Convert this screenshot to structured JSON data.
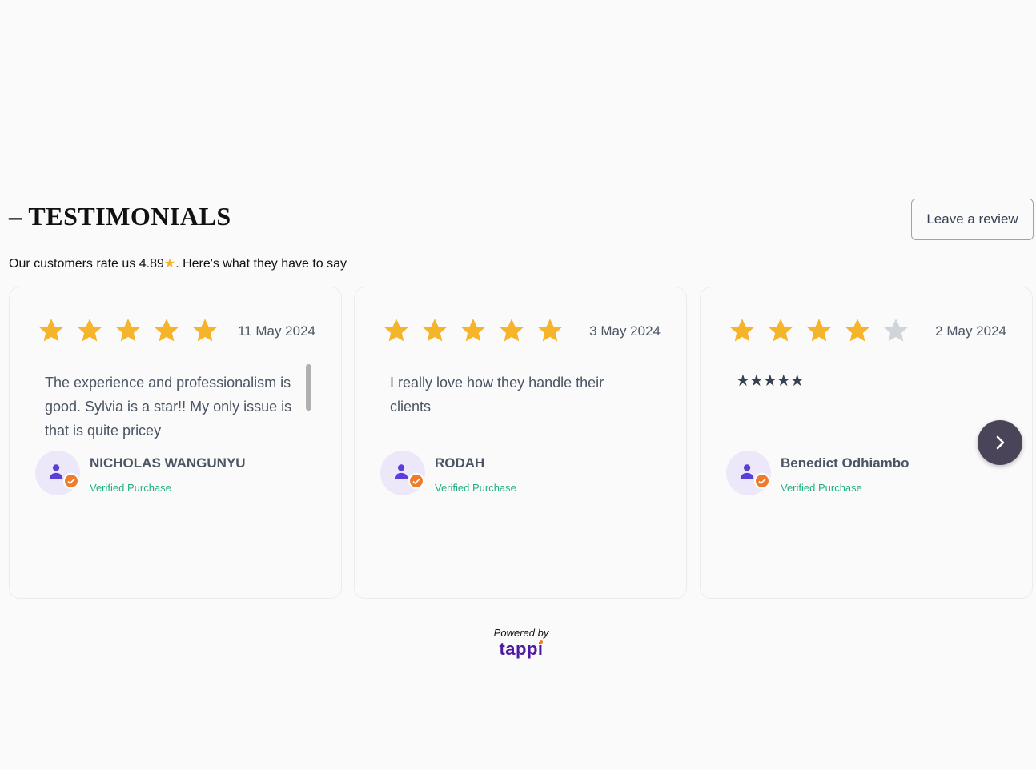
{
  "section": {
    "title": "– TESTIMONIALS",
    "leave_review_label": "Leave a review",
    "subtitle_before": "Our customers rate us 4.89",
    "subtitle_star": "★",
    "subtitle_after": ". Here's what they have to say"
  },
  "reviews": [
    {
      "rating": 5,
      "date": "11 May 2024",
      "text": "The experience and professionalism is good. Sylvia is a star!! My only issue is that is quite pricey",
      "name": "NICHOLAS WANGUNYU",
      "verified": "Verified Purchase"
    },
    {
      "rating": 5,
      "date": "3 May 2024",
      "text": "I really love how they handle their clients",
      "name": "RODAH",
      "verified": "Verified Purchase"
    },
    {
      "rating": 4,
      "date": "2 May 2024",
      "text": "★★★★★",
      "name": "Benedict Odhiambo",
      "verified": "Verified Purchase"
    }
  ],
  "footer": {
    "powered_by": "Powered by",
    "brand": "tappi"
  },
  "colors": {
    "star_filled": "#f6b42b",
    "star_empty": "#d1d5db",
    "verified": "#22b07d",
    "brand": "#4b1aa0",
    "badge": "#f07b2b"
  },
  "icons": {
    "star": "star-icon",
    "avatar": "user-icon",
    "badge": "check-badge-icon",
    "next": "chevron-right-icon"
  }
}
